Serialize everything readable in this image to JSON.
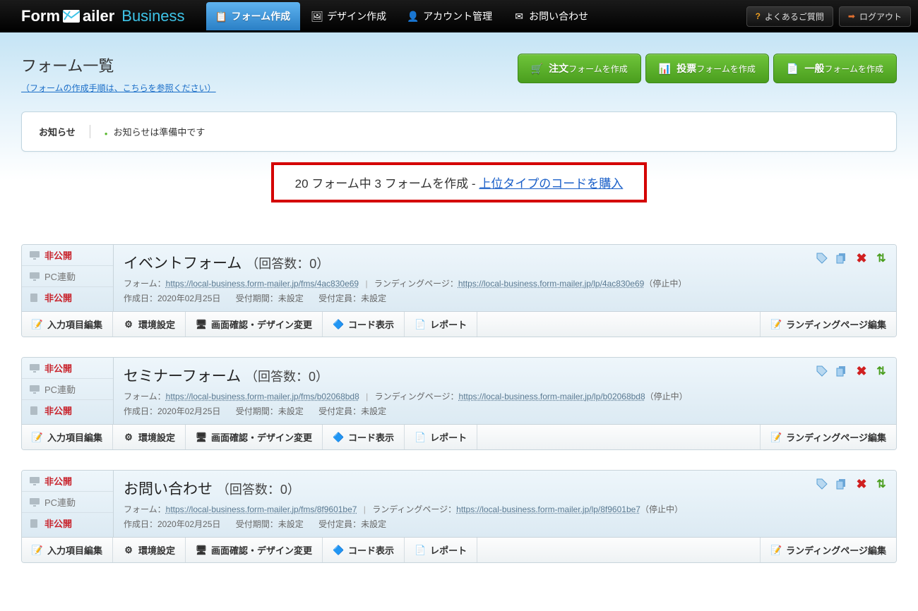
{
  "header": {
    "logo_main": "FormMailer",
    "logo_sub": "Business",
    "tabs": [
      {
        "label": "フォーム作成",
        "active": true
      },
      {
        "label": "デザイン作成",
        "active": false
      },
      {
        "label": "アカウント管理",
        "active": false
      },
      {
        "label": "お問い合わせ",
        "active": false
      }
    ],
    "faq_label": "よくあるご質問",
    "logout_label": "ログアウト"
  },
  "page": {
    "title": "フォーム一覧",
    "help_text": "（フォームの作成手順は、こちらを参照ください）"
  },
  "create_buttons": [
    {
      "main": "注文",
      "sub": "フォームを作成"
    },
    {
      "main": "投票",
      "sub": "フォームを作成"
    },
    {
      "main": "一般",
      "sub": "フォームを作成"
    }
  ],
  "notice": {
    "title": "お知らせ",
    "body": "お知らせは準備中です"
  },
  "quota": {
    "text_prefix": "20 フォーム中 3 フォームを作成 -",
    "link": "上位タイプのコードを購入"
  },
  "status_labels": {
    "private": "非公開",
    "pc_link": "PC連動"
  },
  "labels": {
    "form_prefix": "フォーム：",
    "lp_prefix": "ランディングページ：",
    "created_prefix": "作成日：",
    "period_prefix": "受付期間：",
    "capacity_prefix": "受付定員：",
    "responses_prefix": "（回答数：",
    "responses_suffix": "）",
    "lp_suffix": "（停止中）"
  },
  "actions": {
    "edit_items": "入力項目編集",
    "env": "環境設定",
    "design": "画面確認・デザイン変更",
    "code": "コード表示",
    "report": "レポート",
    "lp_edit": "ランディングページ編集"
  },
  "forms": [
    {
      "name": "イベントフォーム",
      "responses": "0",
      "form_url": "https://local-business.form-mailer.jp/fms/4ac830e69",
      "lp_url": "https://local-business.form-mailer.jp/lp/4ac830e69",
      "created": "2020年02月25日",
      "period": "未設定",
      "capacity": "未設定"
    },
    {
      "name": "セミナーフォーム",
      "responses": "0",
      "form_url": "https://local-business.form-mailer.jp/fms/b02068bd8",
      "lp_url": "https://local-business.form-mailer.jp/lp/b02068bd8",
      "created": "2020年02月25日",
      "period": "未設定",
      "capacity": "未設定"
    },
    {
      "name": "お問い合わせ",
      "responses": "0",
      "form_url": "https://local-business.form-mailer.jp/fms/8f9601be7",
      "lp_url": "https://local-business.form-mailer.jp/lp/8f9601be7",
      "created": "2020年02月25日",
      "period": "未設定",
      "capacity": "未設定"
    }
  ]
}
